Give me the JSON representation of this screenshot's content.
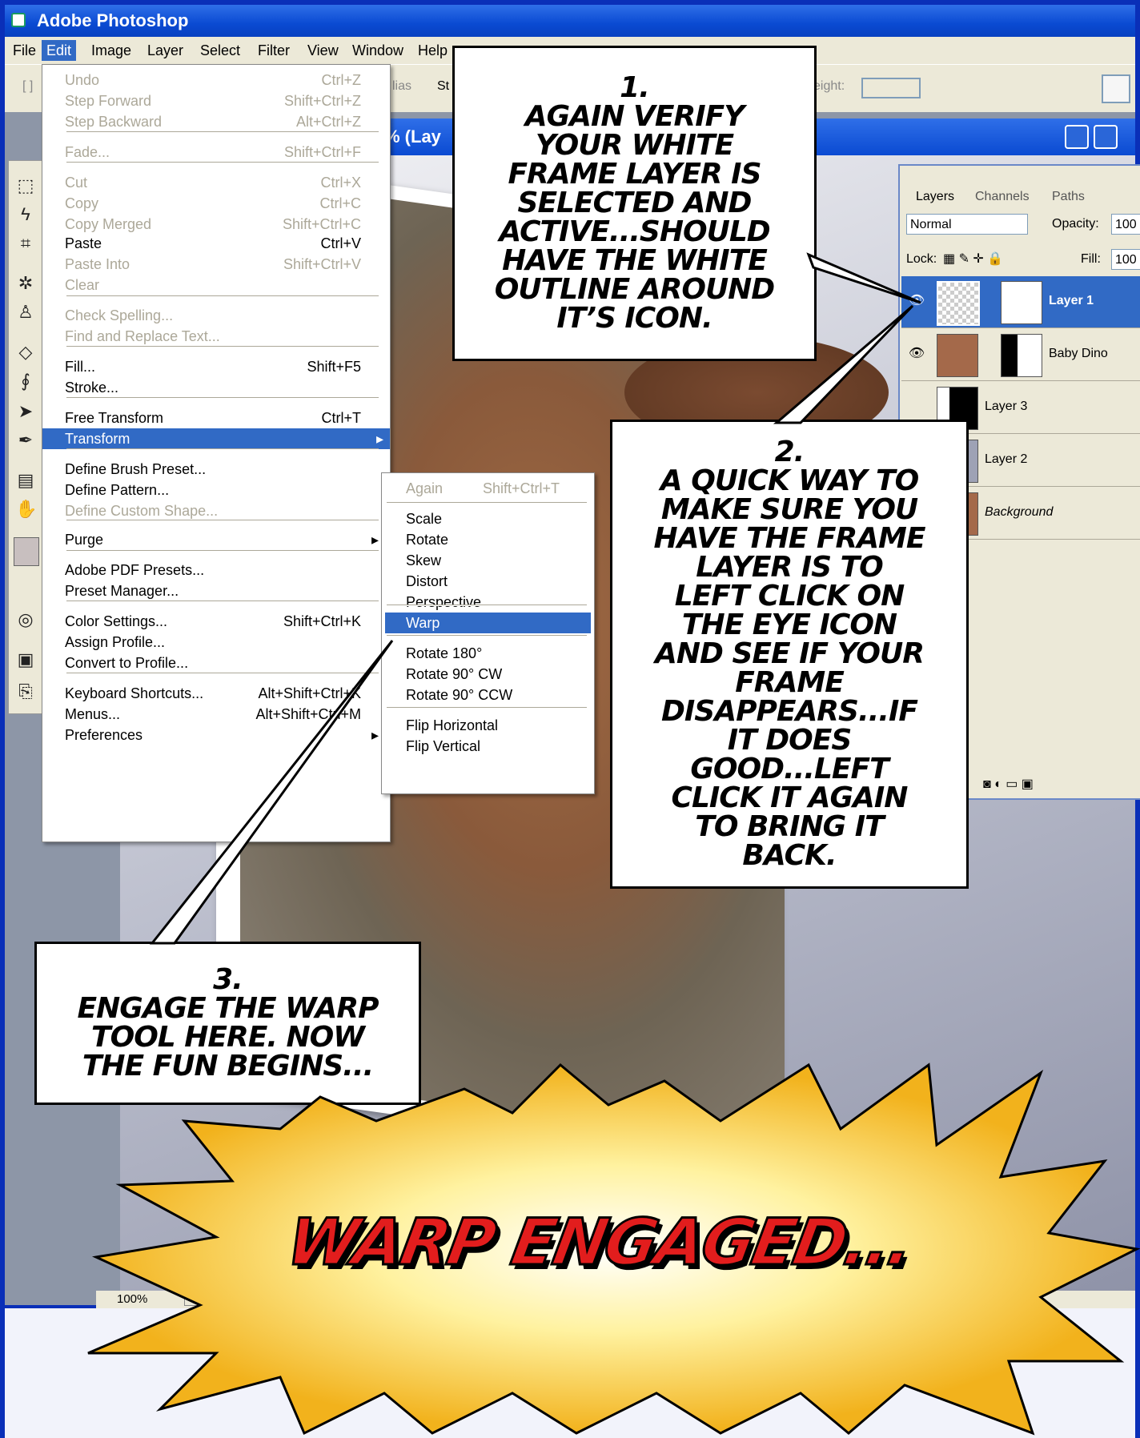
{
  "window": {
    "title": "Adobe Photoshop"
  },
  "menubar": [
    "File",
    "Edit",
    "Image",
    "Layer",
    "Select",
    "Filter",
    "View",
    "Window",
    "Help"
  ],
  "options_bar": {
    "alias_label": "lias",
    "style_label": "St",
    "height_label": "eight:"
  },
  "document": {
    "title_fragment": "% (Lay",
    "zoom": "100%"
  },
  "edit_menu": {
    "items": [
      {
        "label": "Undo",
        "shortcut": "Ctrl+Z",
        "disabled": true
      },
      {
        "label": "Step Forward",
        "shortcut": "Shift+Ctrl+Z",
        "disabled": true
      },
      {
        "label": "Step Backward",
        "shortcut": "Alt+Ctrl+Z",
        "disabled": true
      },
      {
        "label": "Fade...",
        "shortcut": "Shift+Ctrl+F",
        "disabled": true
      },
      {
        "label": "Cut",
        "shortcut": "Ctrl+X",
        "disabled": true
      },
      {
        "label": "Copy",
        "shortcut": "Ctrl+C",
        "disabled": true
      },
      {
        "label": "Copy Merged",
        "shortcut": "Shift+Ctrl+C",
        "disabled": true
      },
      {
        "label": "Paste",
        "shortcut": "Ctrl+V",
        "disabled": false
      },
      {
        "label": "Paste Into",
        "shortcut": "Shift+Ctrl+V",
        "disabled": true
      },
      {
        "label": "Clear",
        "shortcut": "",
        "disabled": true
      },
      {
        "label": "Check Spelling...",
        "shortcut": "",
        "disabled": true
      },
      {
        "label": "Find and Replace Text...",
        "shortcut": "",
        "disabled": true
      },
      {
        "label": "Fill...",
        "shortcut": "Shift+F5",
        "disabled": false
      },
      {
        "label": "Stroke...",
        "shortcut": "",
        "disabled": false
      },
      {
        "label": "Free Transform",
        "shortcut": "Ctrl+T",
        "disabled": false
      },
      {
        "label": "Transform",
        "shortcut": "",
        "disabled": false,
        "highlighted": true,
        "submenu": true
      },
      {
        "label": "Define Brush Preset...",
        "shortcut": "",
        "disabled": false
      },
      {
        "label": "Define Pattern...",
        "shortcut": "",
        "disabled": false
      },
      {
        "label": "Define Custom Shape...",
        "shortcut": "",
        "disabled": true
      },
      {
        "label": "Purge",
        "shortcut": "",
        "disabled": false,
        "submenu": true
      },
      {
        "label": "Adobe PDF Presets...",
        "shortcut": "",
        "disabled": false
      },
      {
        "label": "Preset Manager...",
        "shortcut": "",
        "disabled": false
      },
      {
        "label": "Color Settings...",
        "shortcut": "Shift+Ctrl+K",
        "disabled": false
      },
      {
        "label": "Assign Profile...",
        "shortcut": "",
        "disabled": false
      },
      {
        "label": "Convert to Profile...",
        "shortcut": "",
        "disabled": false
      },
      {
        "label": "Keyboard Shortcuts...",
        "shortcut": "Alt+Shift+Ctrl+K",
        "disabled": false
      },
      {
        "label": "Menus...",
        "shortcut": "Alt+Shift+Ctrl+M",
        "disabled": false
      },
      {
        "label": "Preferences",
        "shortcut": "",
        "disabled": false,
        "submenu": true
      }
    ]
  },
  "transform_submenu": {
    "items": [
      {
        "label": "Again",
        "shortcut": "Shift+Ctrl+T",
        "disabled": true
      },
      {
        "label": "Scale",
        "disabled": false
      },
      {
        "label": "Rotate",
        "disabled": false
      },
      {
        "label": "Skew",
        "disabled": false
      },
      {
        "label": "Distort",
        "disabled": false
      },
      {
        "label": "Perspective",
        "disabled": false
      },
      {
        "label": "Warp",
        "disabled": false,
        "highlighted": true
      },
      {
        "label": "Rotate 180°",
        "disabled": false
      },
      {
        "label": "Rotate 90° CW",
        "disabled": false
      },
      {
        "label": "Rotate 90° CCW",
        "disabled": false
      },
      {
        "label": "Flip Horizontal",
        "disabled": false
      },
      {
        "label": "Flip Vertical",
        "disabled": false
      }
    ]
  },
  "layers_panel": {
    "tabs": [
      "Layers",
      "Channels",
      "Paths"
    ],
    "blend_mode": "Normal",
    "opacity_label": "Opacity:",
    "opacity_value": "100",
    "lock_label": "Lock:",
    "fill_label": "Fill:",
    "fill_value": "100",
    "layers": [
      {
        "name": "Layer 1",
        "selected": true,
        "visible": true
      },
      {
        "name": "Baby Dino",
        "selected": false,
        "visible": true
      },
      {
        "name": "Layer 3",
        "selected": false,
        "visible": false
      },
      {
        "name": "Layer 2",
        "selected": false,
        "visible": false
      },
      {
        "name": "Background",
        "selected": false,
        "visible": false
      }
    ]
  },
  "callouts": {
    "c1": {
      "num": "1.",
      "text": "Again verify\nyour white\nframe layer is\nselected and\nactive...should\nhave the white\noutline around\nit’s icon."
    },
    "c2": {
      "num": "2.",
      "text": "A quick way to\nmake sure you\nhave the frame\nlayer is to\nleft click on\nthe eye icon\nand see if your\nframe\ndisappears...if\nit does\ngood...left\nclick it again\nto bring it\nback."
    },
    "c3": {
      "num": "3.",
      "text": "Engage the warp\ntool here. Now\nthe fun begins..."
    }
  },
  "burst": {
    "text": "Warp Engaged..."
  },
  "colors": {
    "xp_blue": "#0a4ad2",
    "menu_highlight": "#316ac5",
    "burst_yellow": "#f6c71c",
    "burst_text": "#e21d1d"
  }
}
